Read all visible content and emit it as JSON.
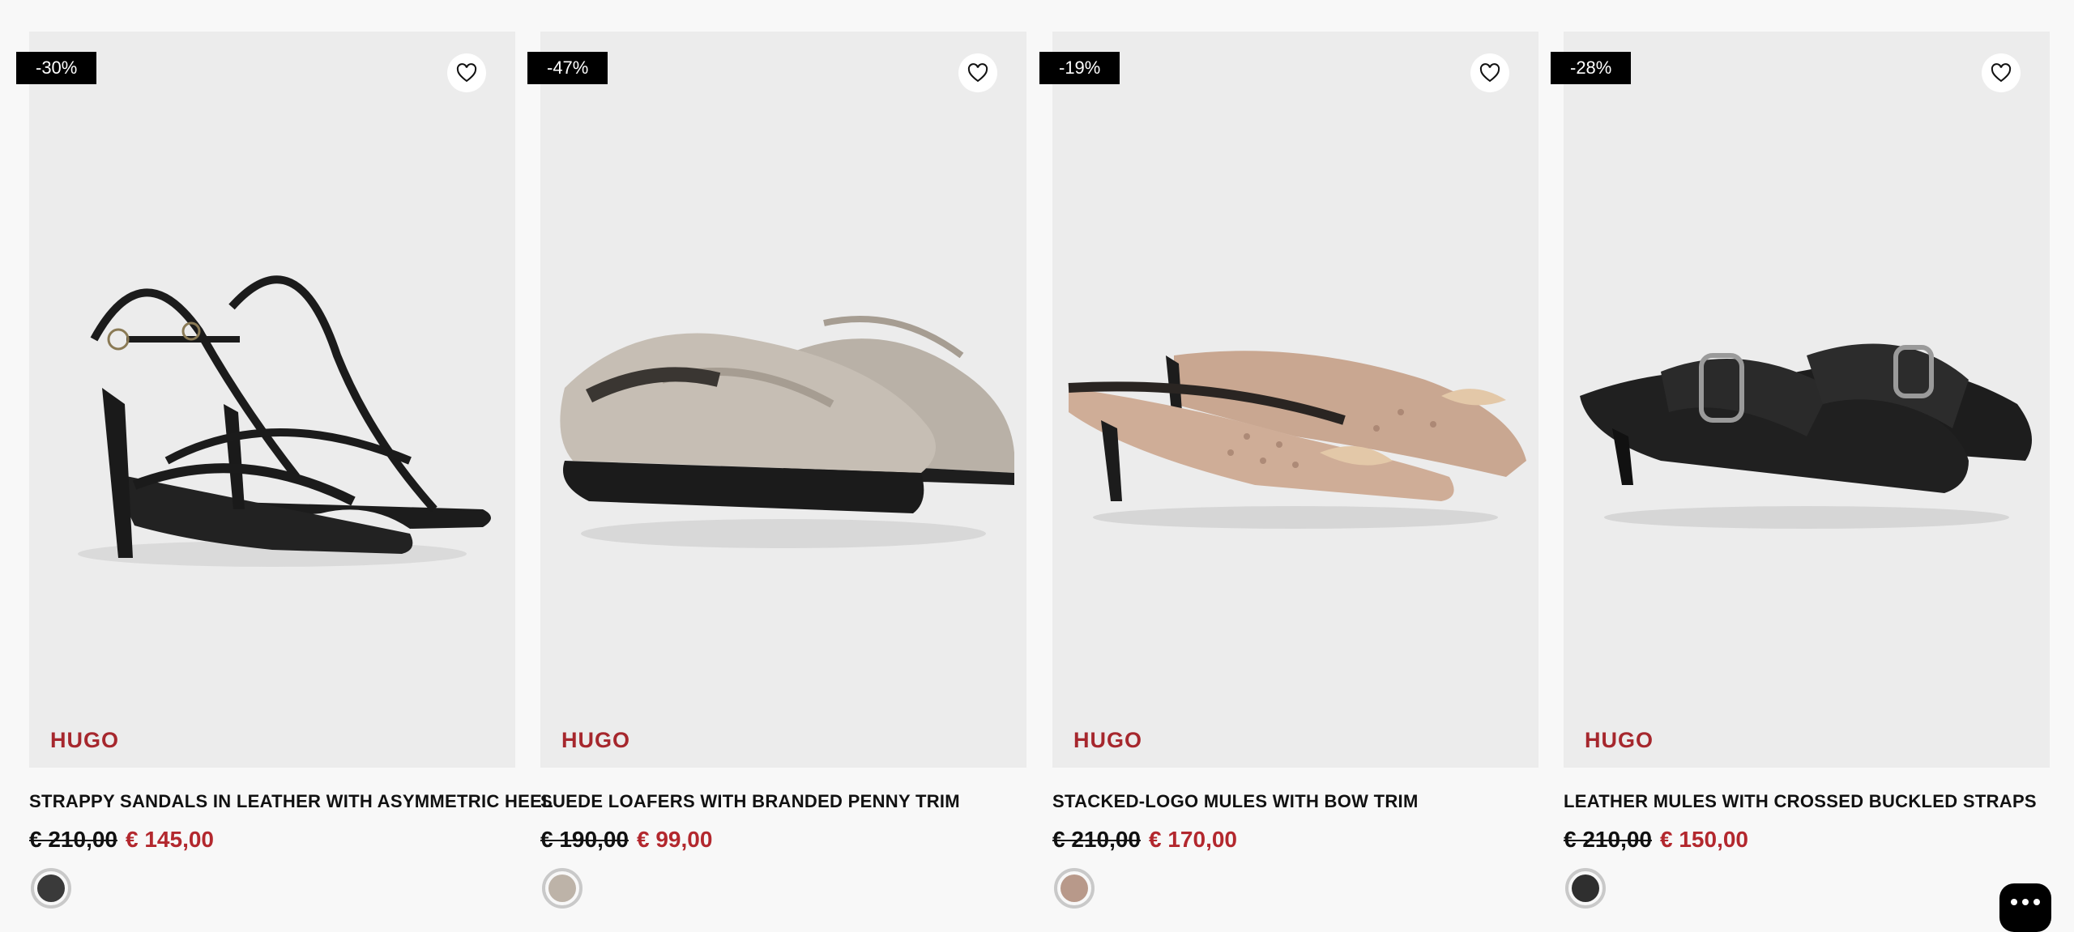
{
  "products": [
    {
      "discount": "-30%",
      "brand": "HUGO",
      "title": "STRAPPY SANDALS IN LEATHER WITH ASYMMETRIC HEEL",
      "old_price": "€ 210,00",
      "new_price": "€ 145,00",
      "swatch_color": "#3a3a3a",
      "image": "black strappy heeled sandals"
    },
    {
      "discount": "-47%",
      "brand": "HUGO",
      "title": "SUEDE LOAFERS WITH BRANDED PENNY TRIM",
      "old_price": "€ 190,00",
      "new_price": "€ 99,00",
      "swatch_color": "#bdb3a8",
      "image": "beige suede penny loafers"
    },
    {
      "discount": "-19%",
      "brand": "HUGO",
      "title": "STACKED-LOGO MULES WITH BOW TRIM",
      "old_price": "€ 210,00",
      "new_price": "€ 170,00",
      "swatch_color": "#b8998a",
      "image": "beige monogram mules with bow"
    },
    {
      "discount": "-28%",
      "brand": "HUGO",
      "title": "LEATHER MULES WITH CROSSED BUCKLED STRAPS",
      "old_price": "€ 210,00",
      "new_price": "€ 150,00",
      "swatch_color": "#2f2f2f",
      "image": "black buckled leather mules"
    }
  ],
  "icons": {
    "wishlist": "heart-icon",
    "chat": "chat-bubble-icon"
  },
  "colors": {
    "brand_red": "#a6272d",
    "sale_red": "#b3282e",
    "badge_bg": "#000000",
    "tile_bg": "#ececec"
  }
}
